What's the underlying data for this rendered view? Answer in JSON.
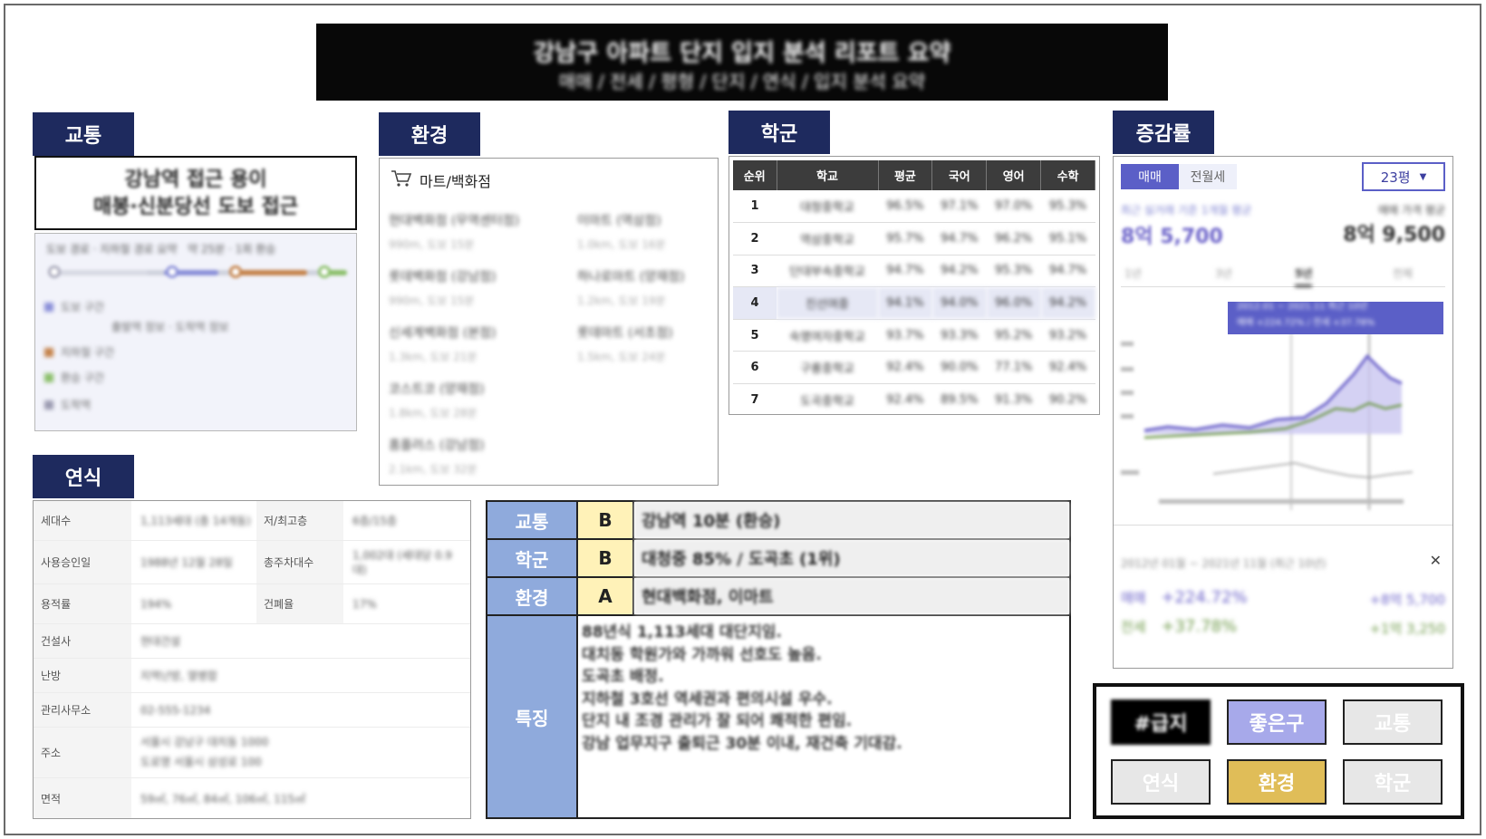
{
  "banner": {
    "line1": "강남구 아파트 단지 입지 분석 리포트 요약",
    "line2": "매매 / 전세 / 평형 / 단지 / 연식 / 입지 분석 요약"
  },
  "sections": {
    "transit": "교통",
    "environment": "환경",
    "school": "학군",
    "rate": "증감률",
    "year": "연식"
  },
  "transit": {
    "headline1": "강남역 접근 용이",
    "headline2": "매봉·신분당선 도보 접근",
    "route_label": "도보 경로 · 지하철 경로 요약",
    "route_meta": "약 25분 · 1회 환승",
    "legend": [
      {
        "color": "#8a8fd8",
        "text": "도보 구간"
      },
      {
        "color": "#c4824a",
        "text": "지하철 구간"
      },
      {
        "color": "#8bbf6a",
        "text": "환승 구간"
      },
      {
        "color": "#9a9ab0",
        "text": "도착역"
      }
    ],
    "legend_notes": "출발역 정보 · 도착역 정보"
  },
  "environment": {
    "category": "마트/백화점",
    "items": [
      {
        "name": "현대백화점 (무역센터점)",
        "dist": "990m, 도보 15분"
      },
      {
        "name": "이마트 (역삼점)",
        "dist": "1.0km, 도보 16분"
      },
      {
        "name": "롯데백화점 (강남점)",
        "dist": "990m, 도보 15분"
      },
      {
        "name": "하나로마트 (양재점)",
        "dist": "1.2km, 도보 19분"
      },
      {
        "name": "신세계백화점 (본점)",
        "dist": "1.3km, 도보 21분"
      },
      {
        "name": "롯데마트 (서초점)",
        "dist": "1.5km, 도보 24분"
      },
      {
        "name": "코스트코 (양재점)",
        "dist": "1.8km, 도보 28분"
      },
      {
        "name": "홈플러스 (강남점)",
        "dist": "2.1km, 도보 32분"
      }
    ]
  },
  "school": {
    "headers": [
      "순위",
      "학교",
      "평균",
      "국어",
      "영어",
      "수학"
    ],
    "rows": [
      {
        "rank": "1",
        "name": "대청중학교",
        "avg": "96.5%",
        "kor": "97.1%",
        "eng": "97.0%",
        "math": "95.3%"
      },
      {
        "rank": "2",
        "name": "역삼중학교",
        "avg": "95.7%",
        "kor": "94.7%",
        "eng": "96.2%",
        "math": "95.1%"
      },
      {
        "rank": "3",
        "name": "단대부속중학교",
        "avg": "94.7%",
        "kor": "94.2%",
        "eng": "95.3%",
        "math": "94.7%"
      },
      {
        "rank": "4",
        "name": "진선여중",
        "avg": "94.1%",
        "kor": "94.0%",
        "eng": "96.0%",
        "math": "94.2%"
      },
      {
        "rank": "5",
        "name": "숙명여자중학교",
        "avg": "93.7%",
        "kor": "93.3%",
        "eng": "95.2%",
        "math": "93.2%"
      },
      {
        "rank": "6",
        "name": "구룡중학교",
        "avg": "92.4%",
        "kor": "90.0%",
        "eng": "77.1%",
        "math": "92.4%"
      },
      {
        "rank": "7",
        "name": "도곡중학교",
        "avg": "92.4%",
        "kor": "89.5%",
        "eng": "91.3%",
        "math": "90.2%"
      }
    ]
  },
  "rate": {
    "tab_sale": "매매",
    "tab_rent": "전월세",
    "size": "23평",
    "size_caret": "▼",
    "recent_label": "최근 실거래 기준 1개월 평균",
    "recent_label2": "매매 가격 평균",
    "price_left": "8억 5,700",
    "price_right": "8억 9,500",
    "range_tabs": [
      "1년",
      "3년",
      "5년",
      "전체"
    ],
    "range_active_index": 2,
    "tooltip_line1": "2012.01 ~ 2021.11 최근 10년",
    "tooltip_line2": "매매 +224.72% / 전세 +37.78%",
    "footer_period": "2012년 01월 ~ 2021년 11월 (최근 10년)",
    "sale_label": "매매",
    "sale_rate": "+224.72%",
    "sale_note": "+8억 5,700",
    "rent_label": "전세",
    "rent_rate": "+37.78%",
    "rent_note": "+1억 3,250",
    "sale_color": "#6c63c9",
    "rent_color": "#6f9a4a"
  },
  "year": {
    "rows": [
      {
        "l1": "세대수",
        "v1": "1,113세대 (총 14개동)",
        "l2": "저/최고층",
        "v2": "6층/15층"
      },
      {
        "l1": "사용승인일",
        "v1": "1988년 12월 28일",
        "l2": "총주차대수",
        "v2": "1,002대 (세대당 0.9대)"
      },
      {
        "l1": "용적률",
        "v1": "194%",
        "l2": "건폐율",
        "v2": "17%"
      },
      {
        "l1": "건설사",
        "v1": "현대건설",
        "l2": "",
        "v2": ""
      },
      {
        "l1": "난방",
        "v1": "지역난방, 열병합",
        "l2": "",
        "v2": ""
      },
      {
        "l1": "관리사무소",
        "v1": "02-555-1234",
        "l2": "",
        "v2": ""
      },
      {
        "l1": "주소",
        "v1": "서울시 강남구 대치동 1000",
        "v1b": "도로명 서울시 삼성로 100",
        "l2": "",
        "v2": ""
      },
      {
        "l1": "면적",
        "v1": "59㎡, 76㎡, 84㎡, 106㎡, 115㎡",
        "l2": "",
        "v2": ""
      }
    ]
  },
  "summary": {
    "rows": [
      {
        "key": "교통",
        "grade": "B",
        "text": "강남역 10분 (환승)"
      },
      {
        "key": "학군",
        "grade": "B",
        "text": "대청중 85% / 도곡초 (1위)"
      },
      {
        "key": "환경",
        "grade": "A",
        "text": "현대백화점, 이마트"
      }
    ],
    "feature_key": "특징",
    "feature_lines": [
      "88년식 1,113세대 대단지임.",
      "대치동 학원가와 가까워 선호도 높음.",
      "도곡초 배정.",
      "지하철 3호선 역세권과 편의시설 우수.",
      "단지 내 조경 관리가 잘 되어 쾌적한 편임.",
      "강남 업무지구 출퇴근 30분 이내, 재건축 기대감."
    ]
  },
  "tags": [
    {
      "label": "#급지",
      "bg": "#000000",
      "fg": "#ffffff"
    },
    {
      "label": "좋은구",
      "bg": "#a7a9ea",
      "fg": "#ffffff"
    },
    {
      "label": "교통",
      "bg": "#e7e7e7",
      "fg": "#ffffff"
    },
    {
      "label": "연식",
      "bg": "#e7e7e7",
      "fg": "#ffffff"
    },
    {
      "label": "환경",
      "bg": "#e0bd58",
      "fg": "#ffffff"
    },
    {
      "label": "학군",
      "bg": "#e7e7e7",
      "fg": "#ffffff"
    }
  ]
}
